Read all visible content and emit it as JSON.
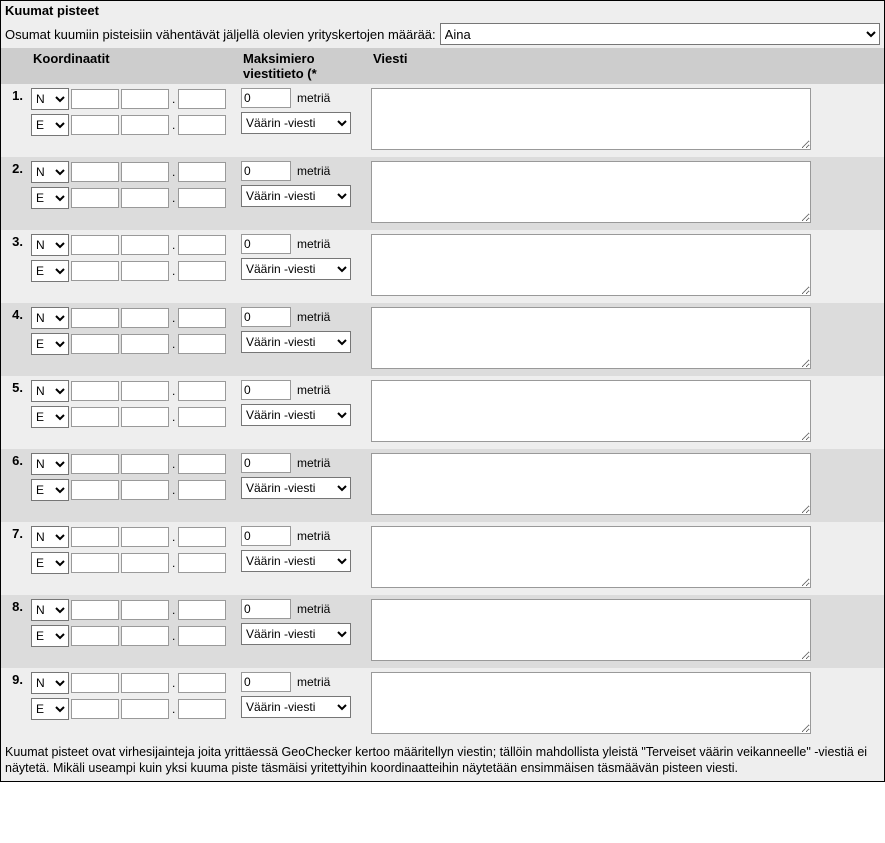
{
  "title": "Kuumat pisteet",
  "hits_reduce_label": "Osumat kuumiin pisteisiin vähentävät jäljellä olevien yrityskertojen määrää:",
  "hits_dropdown_value": "Aina",
  "headers": {
    "coords": "Koordinaatit",
    "maxdiff": "Maksimiero viestitieto (*",
    "msg": "Viesti"
  },
  "lat_dir": "N",
  "lon_dir": "E",
  "distance_value": "0",
  "distance_unit": "metriä",
  "wrong_message_label": "Väärin -viesti",
  "row_numbers": [
    "1.",
    "2.",
    "3.",
    "4.",
    "5.",
    "6.",
    "7.",
    "8.",
    "9."
  ],
  "footer": "Kuumat pisteet ovat virhesijainteja joita yrittäessä GeoChecker kertoo määritellyn viestin; tällöin mahdollista yleistä \"Terveiset väärin veikanneelle\" -viestiä ei näytetä. Mikäli useampi kuin yksi kuuma piste täsmäisi yritettyihin koordinaatteihin näytetään ensimmäisen täsmäävän pisteen viesti."
}
